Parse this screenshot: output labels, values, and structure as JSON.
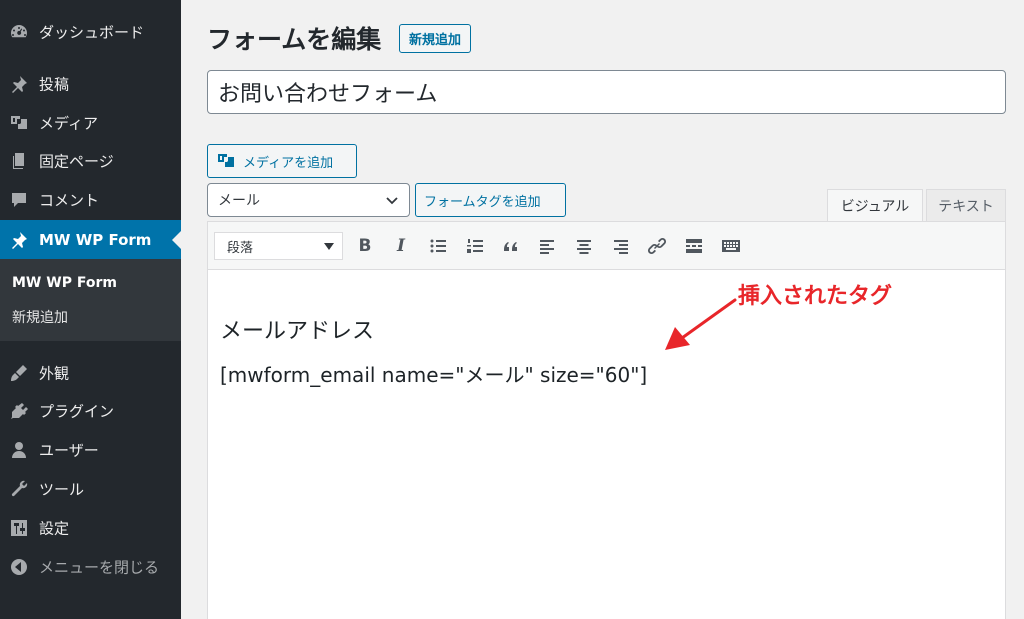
{
  "sidebar": {
    "items": [
      {
        "label": "ダッシュボード",
        "icon": "dashboard-icon"
      },
      {
        "label": "投稿",
        "icon": "pin-icon"
      },
      {
        "label": "メディア",
        "icon": "media-icon"
      },
      {
        "label": "固定ページ",
        "icon": "pages-icon"
      },
      {
        "label": "コメント",
        "icon": "comment-icon"
      },
      {
        "label": "MW WP Form",
        "icon": "pin-icon",
        "active": true
      },
      {
        "label": "外観",
        "icon": "appearance-icon"
      },
      {
        "label": "プラグイン",
        "icon": "plugin-icon"
      },
      {
        "label": "ユーザー",
        "icon": "user-icon"
      },
      {
        "label": "ツール",
        "icon": "wrench-icon"
      },
      {
        "label": "設定",
        "icon": "settings-icon"
      },
      {
        "label": "メニューを閉じる",
        "icon": "collapse-arrow-icon"
      }
    ],
    "submenu": [
      {
        "label": "MW WP Form",
        "current": true
      },
      {
        "label": "新規追加",
        "current": false
      }
    ]
  },
  "header": {
    "title": "フォームを編集",
    "add_new_label": "新規追加"
  },
  "form": {
    "title_value": "お問い合わせフォーム",
    "add_media_label": "メディアを追加",
    "field_select_value": "メール",
    "add_form_tag_label": "フォームタグを追加"
  },
  "editor": {
    "tabs": [
      {
        "label": "ビジュアル",
        "active": true
      },
      {
        "label": "テキスト",
        "active": false
      }
    ],
    "format_select_value": "段落",
    "toolbar_icons": [
      "bold-icon",
      "italic-icon",
      "bullet-list-icon",
      "numbered-list-icon",
      "blockquote-icon",
      "align-left-icon",
      "align-center-icon",
      "align-right-icon",
      "link-icon",
      "read-more-icon",
      "toolbar-toggle-icon"
    ],
    "content": {
      "heading": "メールアドレス",
      "shortcode": "[mwform_email name=\"メール\" size=\"60\"]"
    }
  },
  "annotation": {
    "text": "挿入されたタグ",
    "color": "#e8262a"
  },
  "colors": {
    "sidebar_bg": "#23282d",
    "active_bg": "#0073aa",
    "accent": "#0071a1"
  }
}
